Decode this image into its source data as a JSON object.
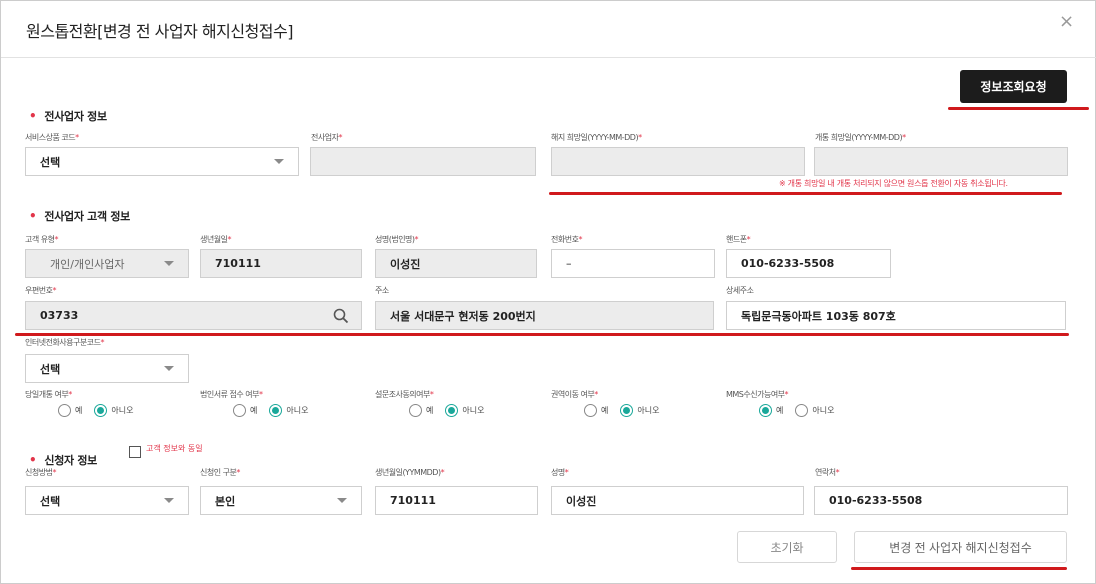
{
  "modal": {
    "title": "원스톱전환[변경 전 사업자 해지신청접수]",
    "close_icon": "close-icon"
  },
  "info_request_button": "정보조회요청",
  "prev_carrier": {
    "section_title": "전사업자 정보",
    "service_code": {
      "label": "서비스상품 코드",
      "req": "*",
      "value": "선택"
    },
    "prev_carrier": {
      "label": "전사업자",
      "req": "*",
      "value": ""
    },
    "cancel_date": {
      "label": "해지 희망일(YYYY-MM-DD)",
      "req": "*",
      "value": ""
    },
    "open_date": {
      "label": "개통 희망일(YYYY-MM-DD)",
      "req": "*",
      "value": ""
    },
    "warning": "※ 개통 희망일 내 개통 처리되지 않으면 원스톱 전환이 자동 취소됩니다."
  },
  "customer": {
    "section_title": "전사업자 고객 정보",
    "type": {
      "label": "고객 유형",
      "req": "*",
      "value": "개인/개인사업자"
    },
    "birth": {
      "label": "생년월일",
      "req": "*",
      "value": "710111"
    },
    "name": {
      "label": "성명(법인명)",
      "req": "*",
      "value": "이성진"
    },
    "phone": {
      "label": "전화번호",
      "req": "*",
      "value": "–"
    },
    "mobile": {
      "label": "핸드폰",
      "req": "*",
      "value": "010-6233-5508"
    },
    "zipcode": {
      "label": "우편번호",
      "req": "*",
      "value": "03733"
    },
    "address": {
      "label": "주소",
      "value": "서울 서대문구 현저동 200번지"
    },
    "address_detail": {
      "label": "상세주소",
      "value": "독립문극동아파트 103동 807호"
    },
    "internet_code": {
      "label": "인터넷전화사용구분코드",
      "req": "*",
      "value": "선택"
    },
    "radios": [
      {
        "label": "당일개통 여부",
        "req": "*",
        "yes": "예",
        "no": "아니오",
        "selected": "no"
      },
      {
        "label": "법인서류 접수 여부",
        "req": "*",
        "yes": "예",
        "no": "아니오",
        "selected": "no"
      },
      {
        "label": "설문조사동의여부",
        "req": "*",
        "yes": "예",
        "no": "아니오",
        "selected": "no"
      },
      {
        "label": "권역이동 여부",
        "req": "*",
        "yes": "예",
        "no": "아니오",
        "selected": "no"
      },
      {
        "label": "MMS수신가능여부",
        "req": "*",
        "yes": "예",
        "no": "아니오",
        "selected": "yes"
      }
    ]
  },
  "applicant": {
    "section_title": "신청자 정보",
    "same_as_customer": "고객 정보와 동일",
    "method": {
      "label": "신청방법",
      "req": "*",
      "value": "선택"
    },
    "relation": {
      "label": "신청인 구분",
      "req": "*",
      "value": "본인"
    },
    "birth": {
      "label": "생년월일(YYMMDD)",
      "req": "*",
      "value": "710111"
    },
    "name": {
      "label": "성명",
      "req": "*",
      "value": "이성진"
    },
    "contact": {
      "label": "연락처",
      "req": "*",
      "value": "010-6233-5508"
    }
  },
  "footer": {
    "reset": "초기화",
    "submit": "변경 전 사업자 해지신청접수"
  },
  "colors": {
    "accent": "#1aa89a",
    "required": "#e2354a",
    "highlight": "#d0191c"
  }
}
